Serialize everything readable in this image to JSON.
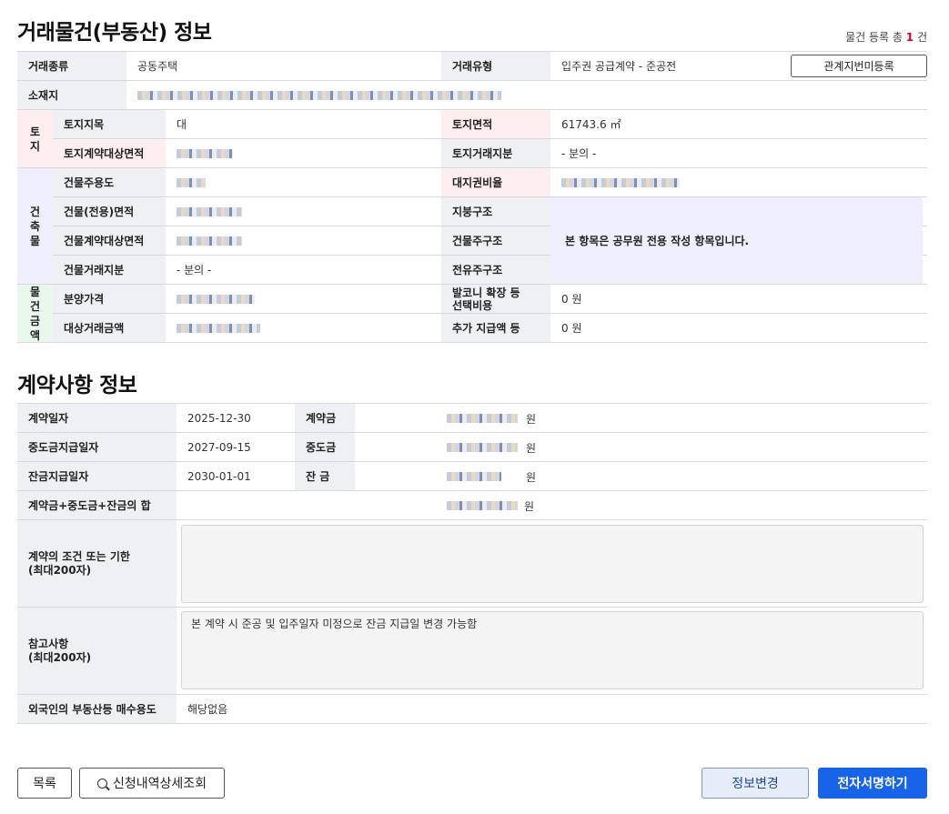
{
  "title": "거래물건(부동산) 정보",
  "count": {
    "prefix": "물건 등록 총",
    "num": "1",
    "suffix": "건"
  },
  "property": {
    "trade_type_label": "거래종류",
    "trade_type_value": "공동주택",
    "trade_kind_label": "거래유형",
    "trade_kind_value": "입주권 공급계약 - 준공전",
    "relation_button": "관계지번미등록",
    "location_label": "소재지",
    "land_group": "토\n지",
    "land_category_label": "토지지목",
    "land_category_value": "대",
    "land_area_label": "토지면적",
    "land_area_value": "61743.6 ㎡",
    "land_contract_area_label": "토지계약대상면적",
    "land_trade_share_label": "토지거래지분",
    "land_trade_share_value": "- 분의 -",
    "building_group": "건\n축\n물",
    "building_use_label": "건물주용도",
    "land_right_ratio_label": "대지권비율",
    "building_area_label": "건물(전용)면적",
    "roof_label": "지붕구조",
    "building_contract_area_label": "건물계약대상면적",
    "main_structure_label": "건물주구조",
    "notice": "본 항목은 공무원 전용 작성 항목입니다.",
    "building_trade_share_label": "건물거래지분",
    "building_trade_share_value": "- 분의 -",
    "exclusive_structure_label": "전유주구조",
    "amount_group": "물\n건\n금\n액",
    "sale_price_label": "분양가격",
    "balcony_label": "발코니 확장 등\n선택비용",
    "balcony_value": "0 원",
    "target_amount_label": "대상거래금액",
    "extra_payment_label": "추가 지급액 등",
    "extra_payment_value": "0 원"
  },
  "contract_title": "계약사항 정보",
  "contract": {
    "contract_date_label": "계약일자",
    "contract_date_value": "2025-12-30",
    "deposit_label": "계약금",
    "interim_date_label": "중도금지급일자",
    "interim_date_value": "2027-09-15",
    "interim_label": "중도금",
    "balance_date_label": "잔금지급일자",
    "balance_date_value": "2030-01-01",
    "balance_label": "잔 금",
    "sum_label": "계약금+중도금+잔금의 합",
    "won": "원",
    "conditions_label": "계약의 조건 또는 기한\n(최대200자)",
    "conditions_value": "",
    "remarks_label": "참고사항\n(최대200자)",
    "remarks_value": "본 계약 시 준공 및 입주일자 미정으로 잔금 지급일 변경 가능함",
    "foreign_label": "외국인의 부동산등 매수용도",
    "foreign_value": "해당없음"
  },
  "buttons": {
    "list": "목록",
    "detail": "신청내역상세조회",
    "edit": "정보변경",
    "sign": "전자서명하기"
  }
}
